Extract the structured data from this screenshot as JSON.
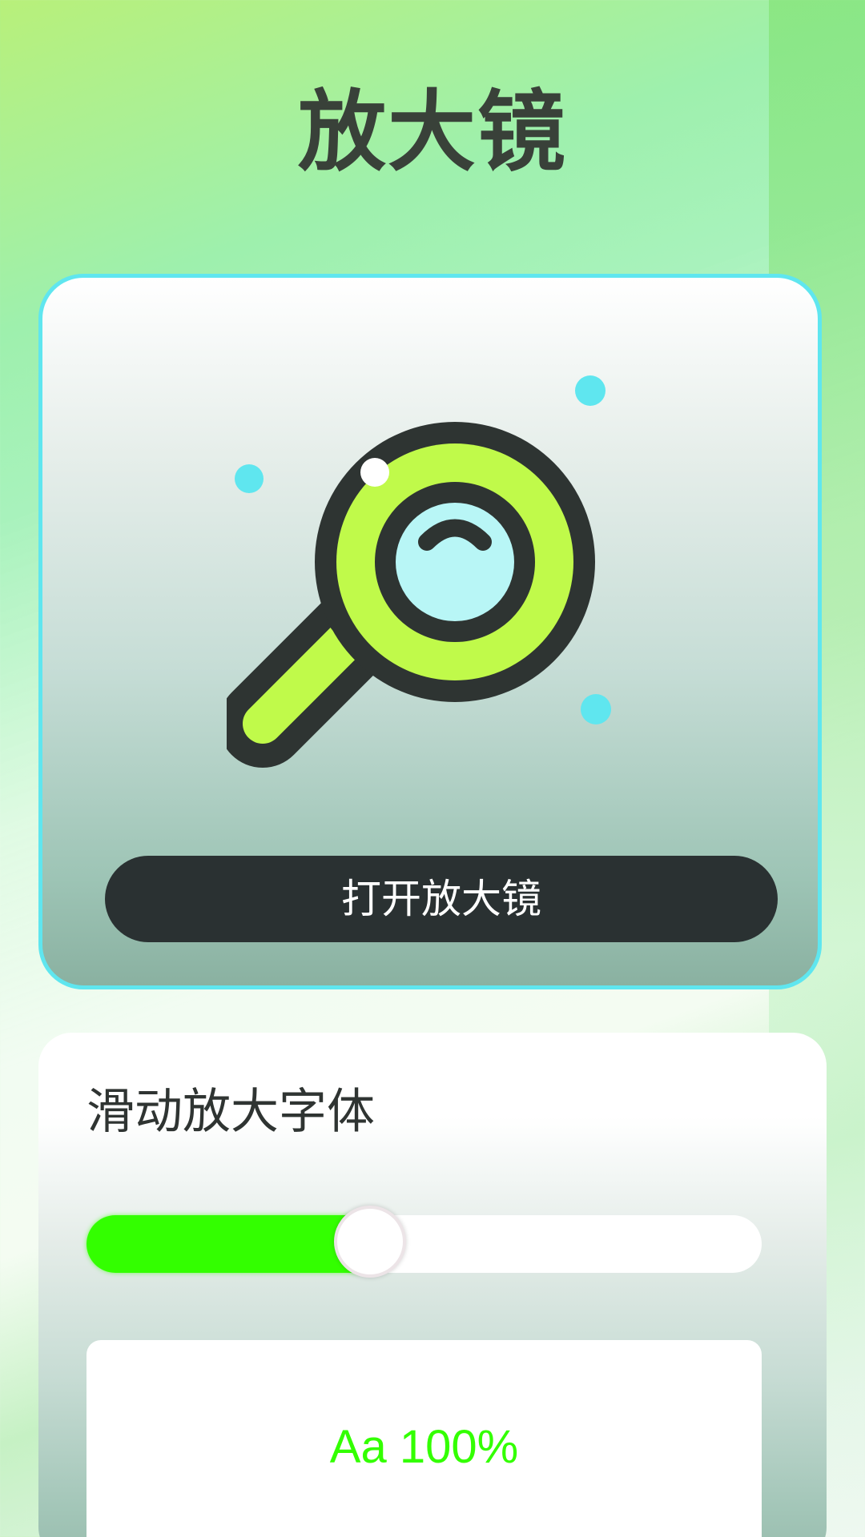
{
  "header": {
    "title": "放大镜"
  },
  "hero": {
    "open_button_label": "打开放大镜",
    "icon": "magnifier-icon",
    "colors": {
      "border": "#5fe6ef",
      "lens_ring": "#c0fa4a",
      "lens_glass": "#b8f6f6",
      "outline": "#2e3432",
      "dots": "#5fe6ef"
    }
  },
  "font_settings": {
    "title": "滑动放大字体",
    "slider": {
      "value_fraction": 0.42,
      "fill_color": "#33ff00"
    },
    "preview_label": "Aa 100%"
  }
}
